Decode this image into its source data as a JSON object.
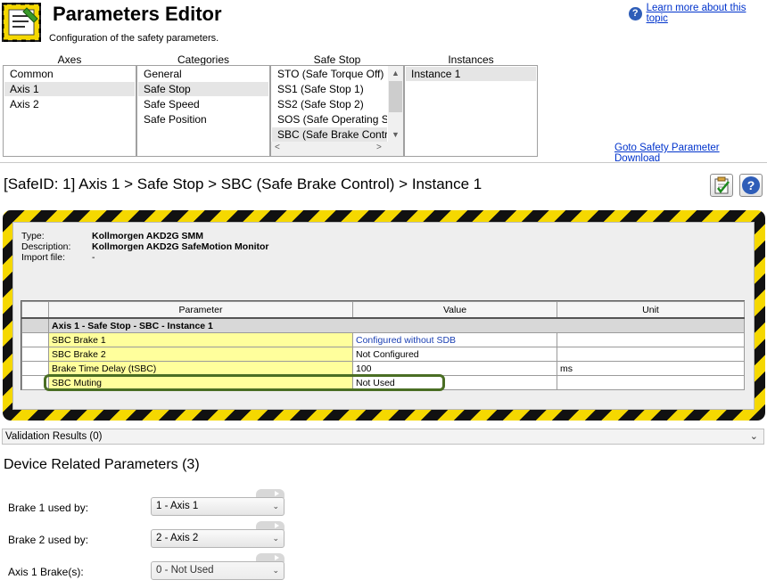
{
  "header": {
    "title": "Parameters Editor",
    "subtitle": "Configuration of the safety parameters.",
    "help_link": "Learn more about this topic"
  },
  "columns": {
    "axes": {
      "heading": "Axes",
      "items": [
        "Common",
        "Axis 1",
        "Axis 2"
      ],
      "selected": 1
    },
    "categories": {
      "heading": "Categories",
      "items": [
        "General",
        "Safe Stop",
        "Safe Speed",
        "Safe Position"
      ],
      "selected": 1
    },
    "safe_stop": {
      "heading": "Safe Stop",
      "items": [
        "STO (Safe Torque Off)",
        "SS1 (Safe Stop 1)",
        "SS2 (Safe Stop 2)",
        "SOS (Safe Operating Sto",
        "SBC (Safe Brake Control)"
      ],
      "selected": 4
    },
    "instances": {
      "heading": "Instances",
      "items": [
        "Instance 1"
      ],
      "selected": 0
    }
  },
  "goto_link": "Goto Safety Parameter Download",
  "breadcrumb": "[SafeID: 1]  Axis 1 > Safe Stop > SBC (Safe Brake Control) > Instance 1",
  "device_info": {
    "type_label": "Type:",
    "type_value": "Kollmorgen AKD2G SMM",
    "description_label": "Description:",
    "description_value": "Kollmorgen AKD2G SafeMotion Monitor",
    "import_label": "Import file:",
    "import_value": "-"
  },
  "param_table": {
    "headers": [
      "Parameter",
      "Value",
      "Unit"
    ],
    "group": "Axis 1 - Safe Stop - SBC - Instance 1",
    "rows": [
      {
        "parameter": "SBC Brake 1",
        "value": "Configured without SDB",
        "unit": ""
      },
      {
        "parameter": "SBC Brake 2",
        "value": "Not Configured",
        "unit": ""
      },
      {
        "parameter": "Brake Time Delay (tSBC)",
        "value": "100",
        "unit": "ms"
      },
      {
        "parameter": "SBC Muting",
        "value": "Not Used",
        "unit": ""
      }
    ]
  },
  "validation": {
    "label": "Validation Results (0)"
  },
  "device_params": {
    "title": "Device Related Parameters (3)",
    "items": [
      {
        "label": "Brake 1 used by:",
        "value": "1 - Axis 1"
      },
      {
        "label": "Brake 2 used by:",
        "value": "2 - Axis 2"
      },
      {
        "label": "Axis 1 Brake(s):",
        "value": "0 - Not Used"
      }
    ]
  },
  "colors": {
    "hazard_yellow": "#f5d800",
    "param_yellow": "#ffff9c",
    "highlight_green": "#4a6e24",
    "link_blue": "#0033cc"
  }
}
